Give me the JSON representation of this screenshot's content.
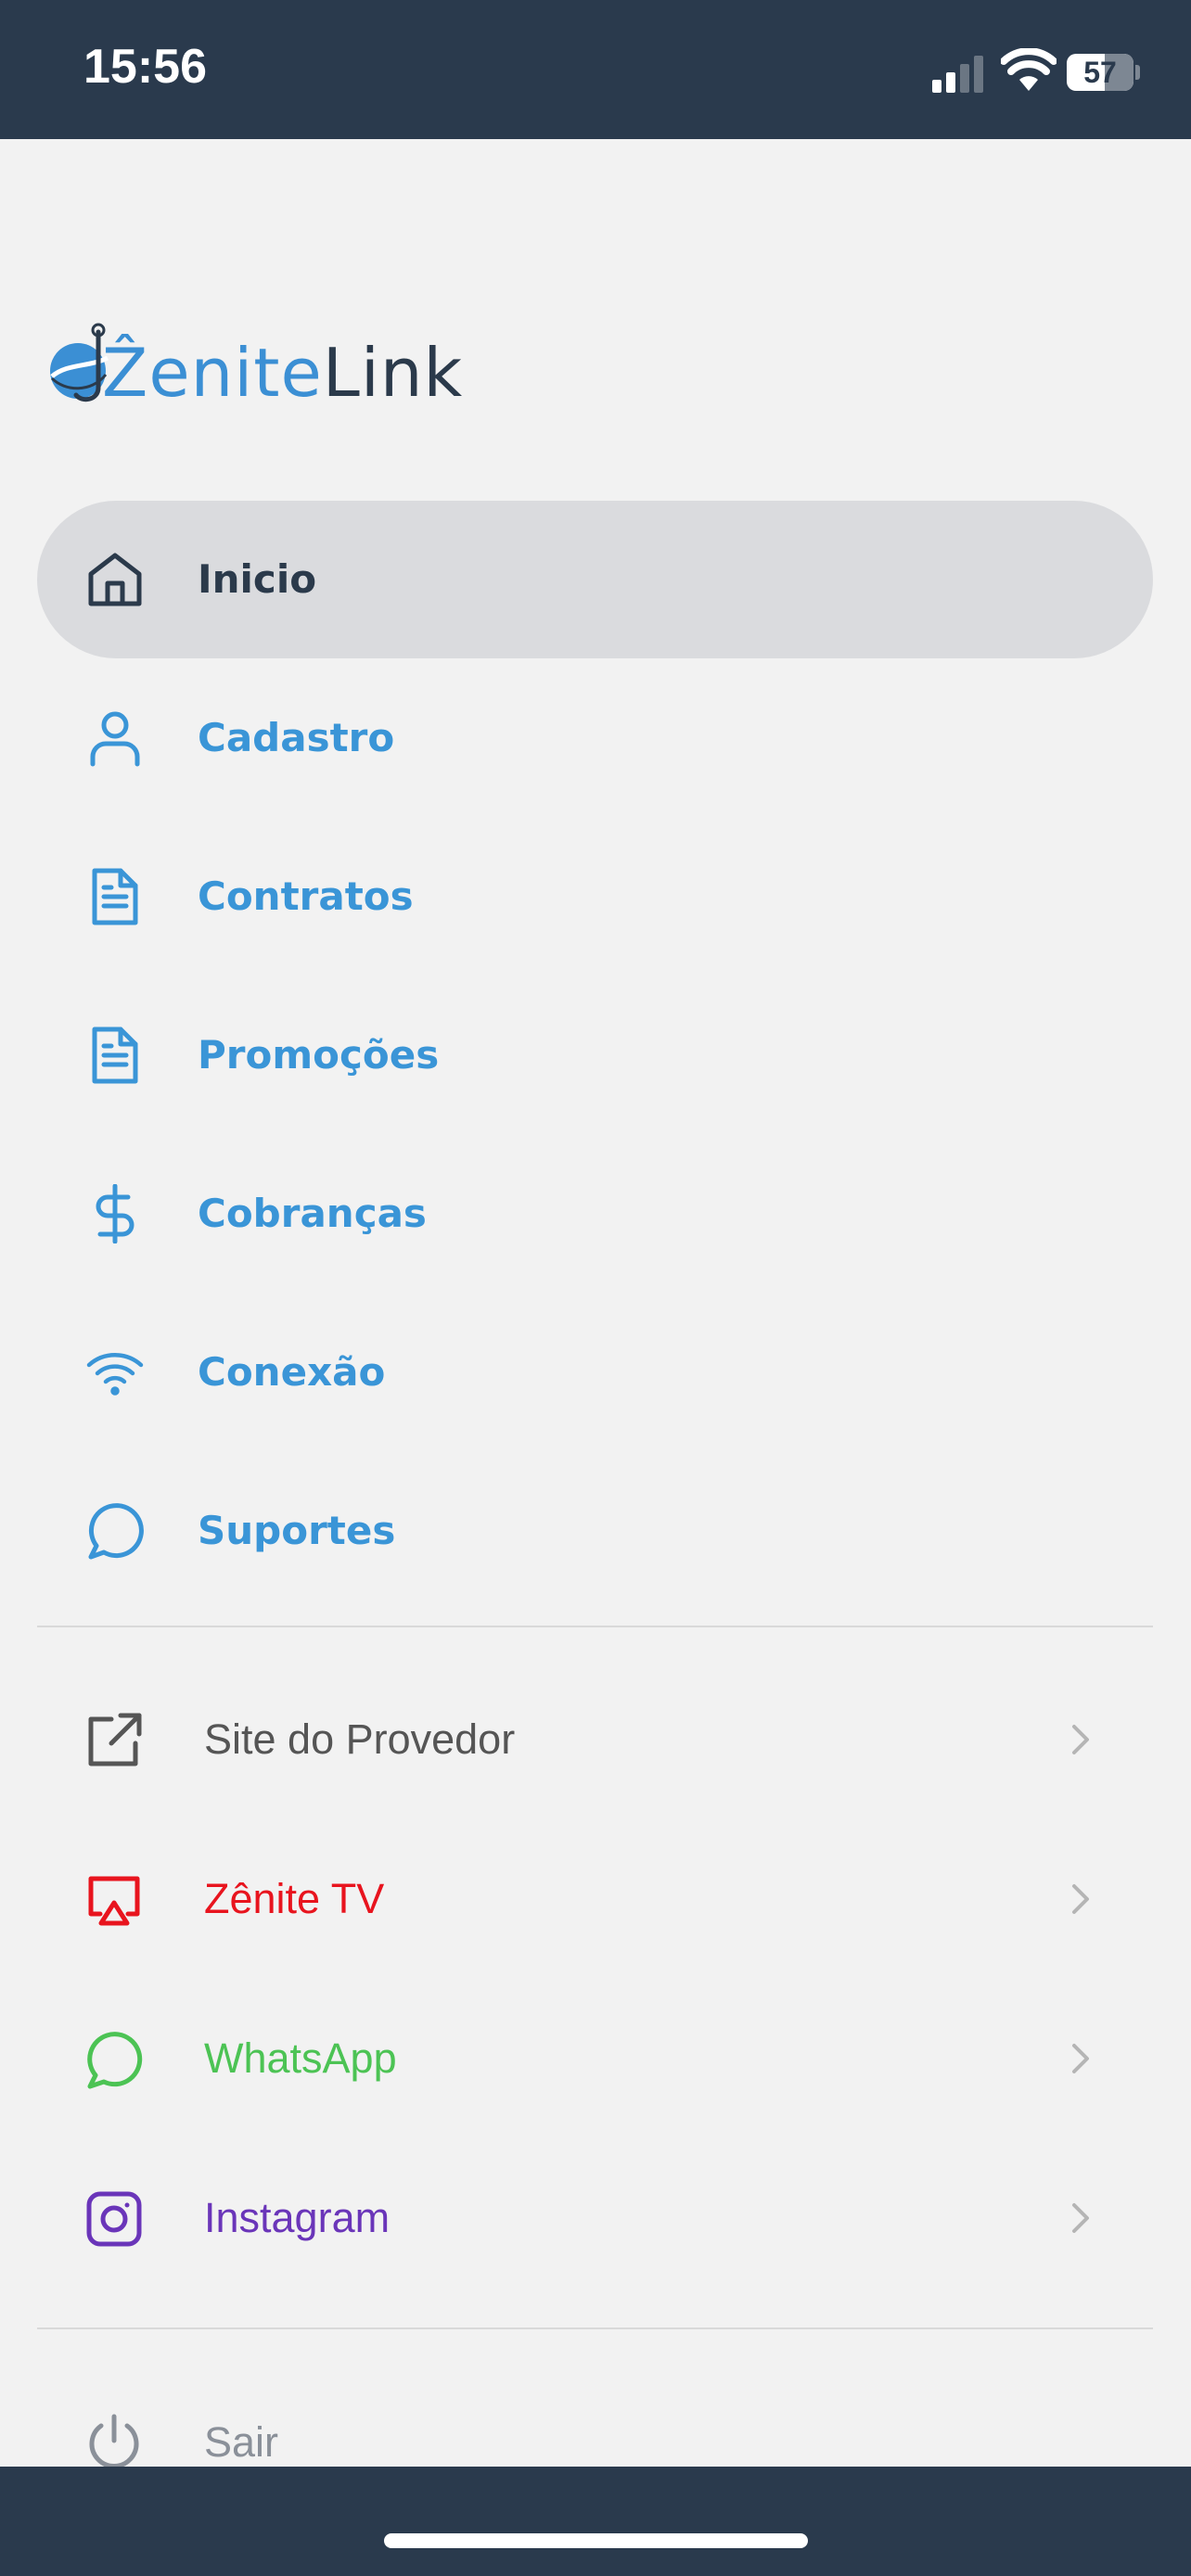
{
  "status_bar": {
    "time": "15:56",
    "battery_level": "57",
    "battery_fraction": 0.57,
    "signal_bars_active": 2,
    "signal_bars_total": 4
  },
  "logo": {
    "text_a": "Ẑenite",
    "text_b": "Link",
    "accent_color": "#3b8fd4",
    "dark_color": "#2b3a4b"
  },
  "menu": {
    "items": [
      {
        "label": "Inicio",
        "icon": "home-icon",
        "active": true
      },
      {
        "label": "Cadastro",
        "icon": "user-icon",
        "active": false
      },
      {
        "label": "Contratos",
        "icon": "document-icon",
        "active": false
      },
      {
        "label": "Promoções",
        "icon": "document-icon",
        "active": false
      },
      {
        "label": "Cobranças",
        "icon": "dollar-icon",
        "active": false
      },
      {
        "label": "Conexão",
        "icon": "wifi-icon",
        "active": false
      },
      {
        "label": "Suportes",
        "icon": "chat-icon",
        "active": false
      }
    ],
    "text_color": "#3a95d7",
    "active_bg": "#dadbde"
  },
  "links": {
    "items": [
      {
        "label": "Site do Provedor",
        "icon": "external-link-icon",
        "color": "#555555"
      },
      {
        "label": "Zênite TV",
        "icon": "airplay-icon",
        "color": "#e8141e"
      },
      {
        "label": "WhatsApp",
        "icon": "whatsapp-icon",
        "color": "#4cc354"
      },
      {
        "label": "Instagram",
        "icon": "instagram-icon",
        "color": "#6a35b9"
      }
    ]
  },
  "logout": {
    "label": "Sair",
    "icon": "power-icon",
    "color": "#8a9099"
  }
}
